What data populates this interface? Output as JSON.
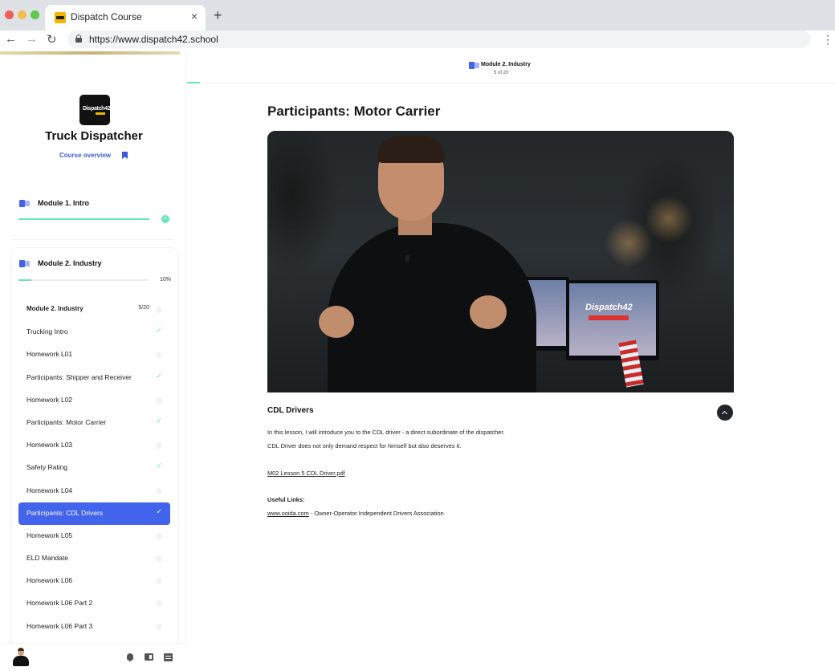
{
  "browser": {
    "tab_title": "Dispatch Course",
    "tab_close": "×",
    "new_tab": "+",
    "url": "https://www.dispatch42.school",
    "back": "←",
    "forward": "→",
    "reload": "↻",
    "menu": "⋮",
    "traffic_colors": [
      "#ee5f57",
      "#f4be4f",
      "#5ec94a"
    ]
  },
  "sidebar": {
    "logo_text": "Dispatch42",
    "course_title": "Truck Dispatcher",
    "course_overview": "Course overview",
    "module1": {
      "title": "Module 1. Intro",
      "progress": 1.0,
      "status": "✓"
    },
    "module2": {
      "title": "Module 2. Industry",
      "progress": 0.1,
      "percent_label": "10%",
      "list_header": "Module 2. Industry",
      "list_count": "5/20",
      "lessons": [
        {
          "label": "Trucking Intro",
          "status": "done"
        },
        {
          "label": "Homework L01",
          "status": "todo"
        },
        {
          "label": "Participants: Shipper and Receiver",
          "status": "done"
        },
        {
          "label": "Homework L02",
          "status": "todo"
        },
        {
          "label": "Participants: Motor Carrier",
          "status": "done"
        },
        {
          "label": "Homework L03",
          "status": "todo"
        },
        {
          "label": "Safety Rating",
          "status": "done"
        },
        {
          "label": "Homework L04",
          "status": "todo"
        },
        {
          "label": "Participants: CDL Drivers",
          "status": "active"
        },
        {
          "label": "Homework L05",
          "status": "todo"
        },
        {
          "label": "ELD Mandate",
          "status": "todo"
        },
        {
          "label": "Homework L06",
          "status": "todo"
        },
        {
          "label": "Homework L06 Part 2",
          "status": "todo"
        },
        {
          "label": "Homework L06 Part 3",
          "status": "todo"
        }
      ]
    },
    "check_glyph": "✓"
  },
  "header": {
    "module_title": "Module 2. Industry",
    "position": "5 of 20"
  },
  "main": {
    "lesson_title": "Participants: Motor Carrier",
    "video_screen_text": "Dispatch42",
    "section_title": "CDL Drivers",
    "paragraph1": "In this lesson, I will introduce you to the CDL driver - a direct subordinate of the dispatcher.",
    "paragraph2": "CDL Driver does not only demand respect for himself but also deserves it.",
    "attachment": "M02 Lesson 5 CDL Driver.pdf",
    "useful_links_label": "Useful Links:",
    "link_text": "www.ooida.com",
    "link_desc": " - Owner-Operator Independent Drivers Association"
  },
  "colors": {
    "accent": "#4263eb",
    "progress": "#63e6be"
  }
}
